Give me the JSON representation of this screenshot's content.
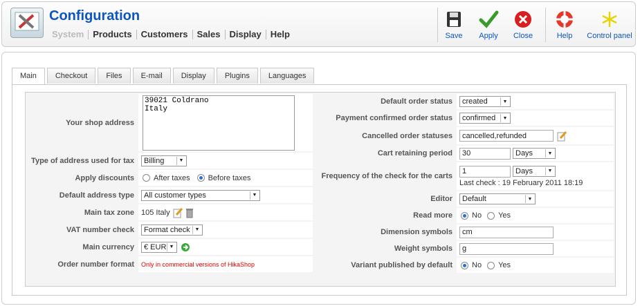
{
  "header": {
    "title": "Configuration",
    "menu": [
      "System",
      "Products",
      "Customers",
      "Sales",
      "Display",
      "Help"
    ],
    "toolbar": {
      "save": "Save",
      "apply": "Apply",
      "close": "Close",
      "help": "Help",
      "control_panel": "Control panel"
    }
  },
  "tabs": [
    "Main",
    "Checkout",
    "Files",
    "E-mail",
    "Display",
    "Plugins",
    "Languages"
  ],
  "left": {
    "shop_address_label": "Your shop address",
    "shop_address_value": "39021 Coldrano\nItaly",
    "address_type_label": "Type of address used for tax",
    "address_type_value": "Billing",
    "apply_discounts_label": "Apply discounts",
    "after_taxes": "After taxes",
    "before_taxes": "Before taxes",
    "default_address_type_label": "Default address type",
    "default_address_type_value": "All customer types",
    "main_tax_zone_label": "Main tax zone",
    "main_tax_zone_value": "105 Italy",
    "vat_check_label": "VAT number check",
    "vat_check_value": "Format check",
    "main_currency_label": "Main currency",
    "main_currency_value": "€ EUR",
    "order_number_label": "Order number format",
    "order_number_value": "Only in commercial versions of HikaShop"
  },
  "right": {
    "default_order_status_label": "Default order status",
    "default_order_status_value": "created",
    "payment_confirmed_label": "Payment confirmed order status",
    "payment_confirmed_value": "confirmed",
    "cancelled_label": "Cancelled order statuses",
    "cancelled_value": "cancelled,refunded",
    "cart_period_label": "Cart retaining period",
    "cart_period_value": "30",
    "cart_period_unit": "Days",
    "frequency_label": "Frequency of the check for the carts",
    "frequency_value": "1",
    "frequency_unit": "Days",
    "last_check": "Last check : 19 February 2011 18:19",
    "editor_label": "Editor",
    "editor_value": "Default",
    "read_more_label": "Read more",
    "no": "No",
    "yes": "Yes",
    "dimension_label": "Dimension symbols",
    "dimension_value": "cm",
    "weight_label": "Weight symbols",
    "weight_value": "g",
    "variant_label": "Variant published by default"
  }
}
